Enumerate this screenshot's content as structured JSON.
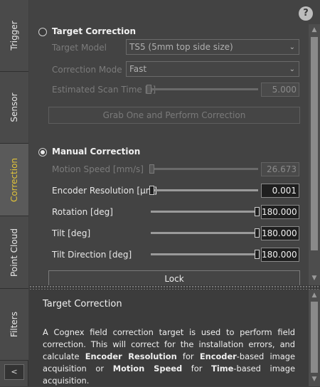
{
  "tabs": [
    {
      "label": "Trigger",
      "active": false
    },
    {
      "label": "Sensor",
      "active": false
    },
    {
      "label": "Correction",
      "active": true
    },
    {
      "label": "Point Cloud",
      "active": false
    },
    {
      "label": "Filters",
      "active": false
    }
  ],
  "collapse_label": "<",
  "help_icon_label": "?",
  "target_correction": {
    "header": "Target Correction",
    "selected": false,
    "target_model_label": "Target Model",
    "target_model_value": "TS5 (5mm top side size)",
    "correction_mode_label": "Correction Mode",
    "correction_mode_value": "Fast",
    "scan_time_label": "Estimated Scan Time [s]",
    "scan_time_value": "5.000",
    "grab_button_label": "Grab One and Perform Correction"
  },
  "manual_correction": {
    "header": "Manual Correction",
    "selected": true,
    "motion_speed_label": "Motion Speed [mm/s]",
    "motion_speed_value": "26.673",
    "encoder_resolution_label": "Encoder Resolution [µm]",
    "encoder_resolution_value": "0.001",
    "rotation_label": "Rotation [deg]",
    "rotation_value": "180.000",
    "tilt_label": "Tilt [deg]",
    "tilt_value": "180.000",
    "tilt_direction_label": "Tilt Direction [deg]",
    "tilt_direction_value": "180.000",
    "lock_button_label": "Lock"
  },
  "help_panel": {
    "title": "Target Correction",
    "p1": "A Cognex field correction target is used to perform field correction. This will correct for the installation errors, and calculate ",
    "b1": "Encoder Resolution",
    "p2": " for ",
    "b2": "Encoder",
    "p3": "-based image acquisition or ",
    "b3": "Motion Speed",
    "p4": " for ",
    "b4": "Time",
    "p5": "-based image acquisition."
  },
  "colors": {
    "active_tab_text": "#e0c33a",
    "panel_bg": "#434343"
  },
  "icons": [
    "help-icon",
    "chevron-down-icon",
    "scroll-up-icon",
    "scroll-down-icon",
    "collapse-icon"
  ]
}
